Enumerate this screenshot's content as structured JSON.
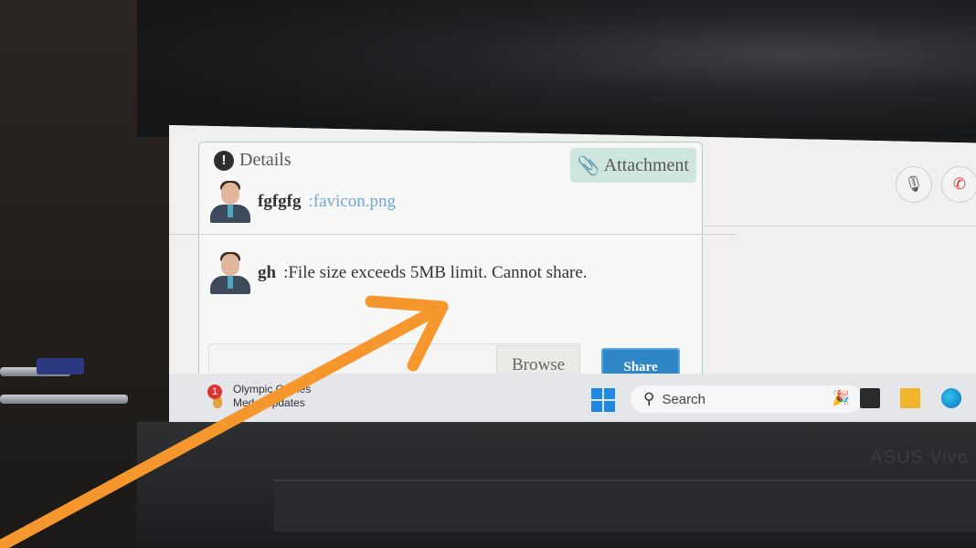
{
  "chat": {
    "details_label": "Details",
    "attachment_label": "Attachment",
    "messages": [
      {
        "sender": "fgfgfg",
        "separator": ":",
        "text": "favicon.png",
        "is_file": true
      },
      {
        "sender": "gh",
        "separator": ":",
        "text": "File size exceeds 5MB limit. Cannot share.",
        "is_file": false
      }
    ],
    "browse_label": "Browse",
    "share_label": "Share"
  },
  "taskbar": {
    "weather_badge": "1",
    "weather_line1": "Olympic Games",
    "weather_line2": "Medal updates",
    "search_placeholder": "Search"
  },
  "device": {
    "brand_text": "ASUS Vivo"
  },
  "colors": {
    "share_button": "#2f86c6",
    "attachment_bg": "#cfe6de",
    "annotation_arrow": "#f5972c",
    "file_link": "#6fa8d6"
  },
  "icons": [
    "info-icon",
    "paperclip-icon",
    "mic-off-icon",
    "phone-hangup-icon",
    "windows-start-icon",
    "search-icon",
    "task-view-icon",
    "file-explorer-icon",
    "edge-icon"
  ]
}
